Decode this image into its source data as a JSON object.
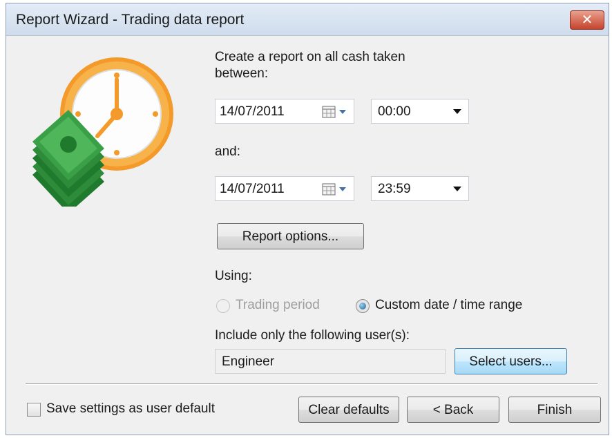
{
  "window": {
    "title": "Report Wizard - Trading data report",
    "close_label": "✕"
  },
  "prompt": "Create a report on all cash taken between:",
  "start": {
    "date": "14/07/2011",
    "time": "00:00"
  },
  "and_label": "and:",
  "end": {
    "date": "14/07/2011",
    "time": "23:59"
  },
  "report_options_label": "Report options...",
  "using_label": "Using:",
  "radio_trading_period": "Trading period",
  "radio_custom_range": "Custom date / time range",
  "selected_radio": "custom_range",
  "include_users_label": "Include only the following user(s):",
  "users_value": "Engineer",
  "select_users_label": "Select users...",
  "save_default_label": "Save settings as user default",
  "save_default_checked": false,
  "buttons": {
    "clear_defaults": "Clear defaults",
    "back": "< Back",
    "finish": "Finish"
  },
  "icons": {
    "wizard": "clock-money-icon",
    "calendar": "calendar-icon",
    "dropdown": "chevron-down-icon"
  },
  "colors": {
    "clock_orange": "#f39a2b",
    "money_green": "#2e8b3a",
    "focus_blue": "#3c7fb1"
  }
}
